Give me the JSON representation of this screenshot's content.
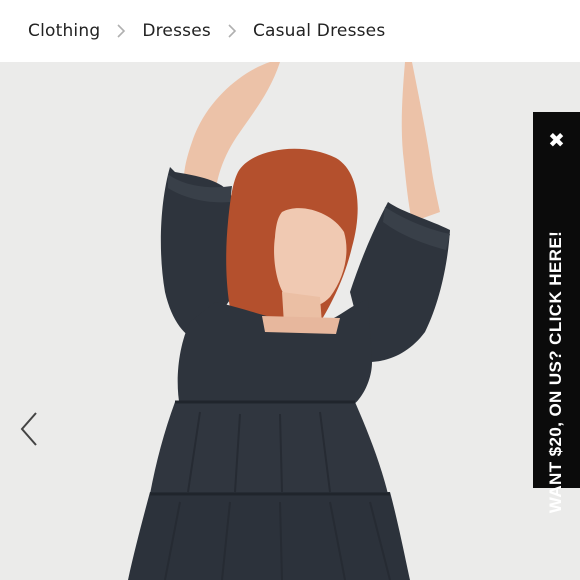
{
  "breadcrumb": {
    "items": [
      "Clothing",
      "Dresses",
      "Casual Dresses"
    ]
  },
  "icons": {
    "separator": "chevron-right-icon",
    "prev": "chevron-left-icon",
    "close": "close-icon"
  },
  "promo": {
    "text": "WANT $20, ON US? CLICK HERE!",
    "close_label": "✖"
  },
  "colors": {
    "promo_background": "#0b0b0b",
    "photo_background": "#ebebea",
    "dress": "#2e343d"
  }
}
